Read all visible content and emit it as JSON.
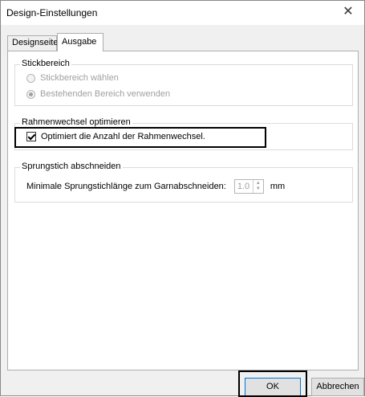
{
  "window": {
    "title": "Design-Einstellungen",
    "close_glyph": "✕"
  },
  "tabs": [
    {
      "label": "Designseite",
      "active": false
    },
    {
      "label": "Ausgabe",
      "active": true
    }
  ],
  "groups": {
    "stickbereich": {
      "label": "Stickbereich",
      "options": [
        {
          "label": "Stickbereich wählen",
          "selected": false,
          "enabled": false
        },
        {
          "label": "Bestehenden Bereich verwenden",
          "selected": true,
          "enabled": false
        }
      ]
    },
    "rahmenwechsel": {
      "label": "Rahmenwechsel optimieren",
      "checkbox_label": "Optimiert die Anzahl der Rahmenwechsel.",
      "checked": true
    },
    "sprungstich": {
      "label": "Sprungstich abschneiden",
      "field_label": "Minimale Sprungstichlänge zum Garnabschneiden:",
      "value": "1.0",
      "unit": "mm"
    }
  },
  "buttons": {
    "ok": "OK",
    "cancel": "Abbrechen"
  },
  "colors": {
    "dialog_bg": "#f0f0f0",
    "page_bg": "#ffffff",
    "disabled_text": "#a0a0a0",
    "highlight": "#000000"
  }
}
